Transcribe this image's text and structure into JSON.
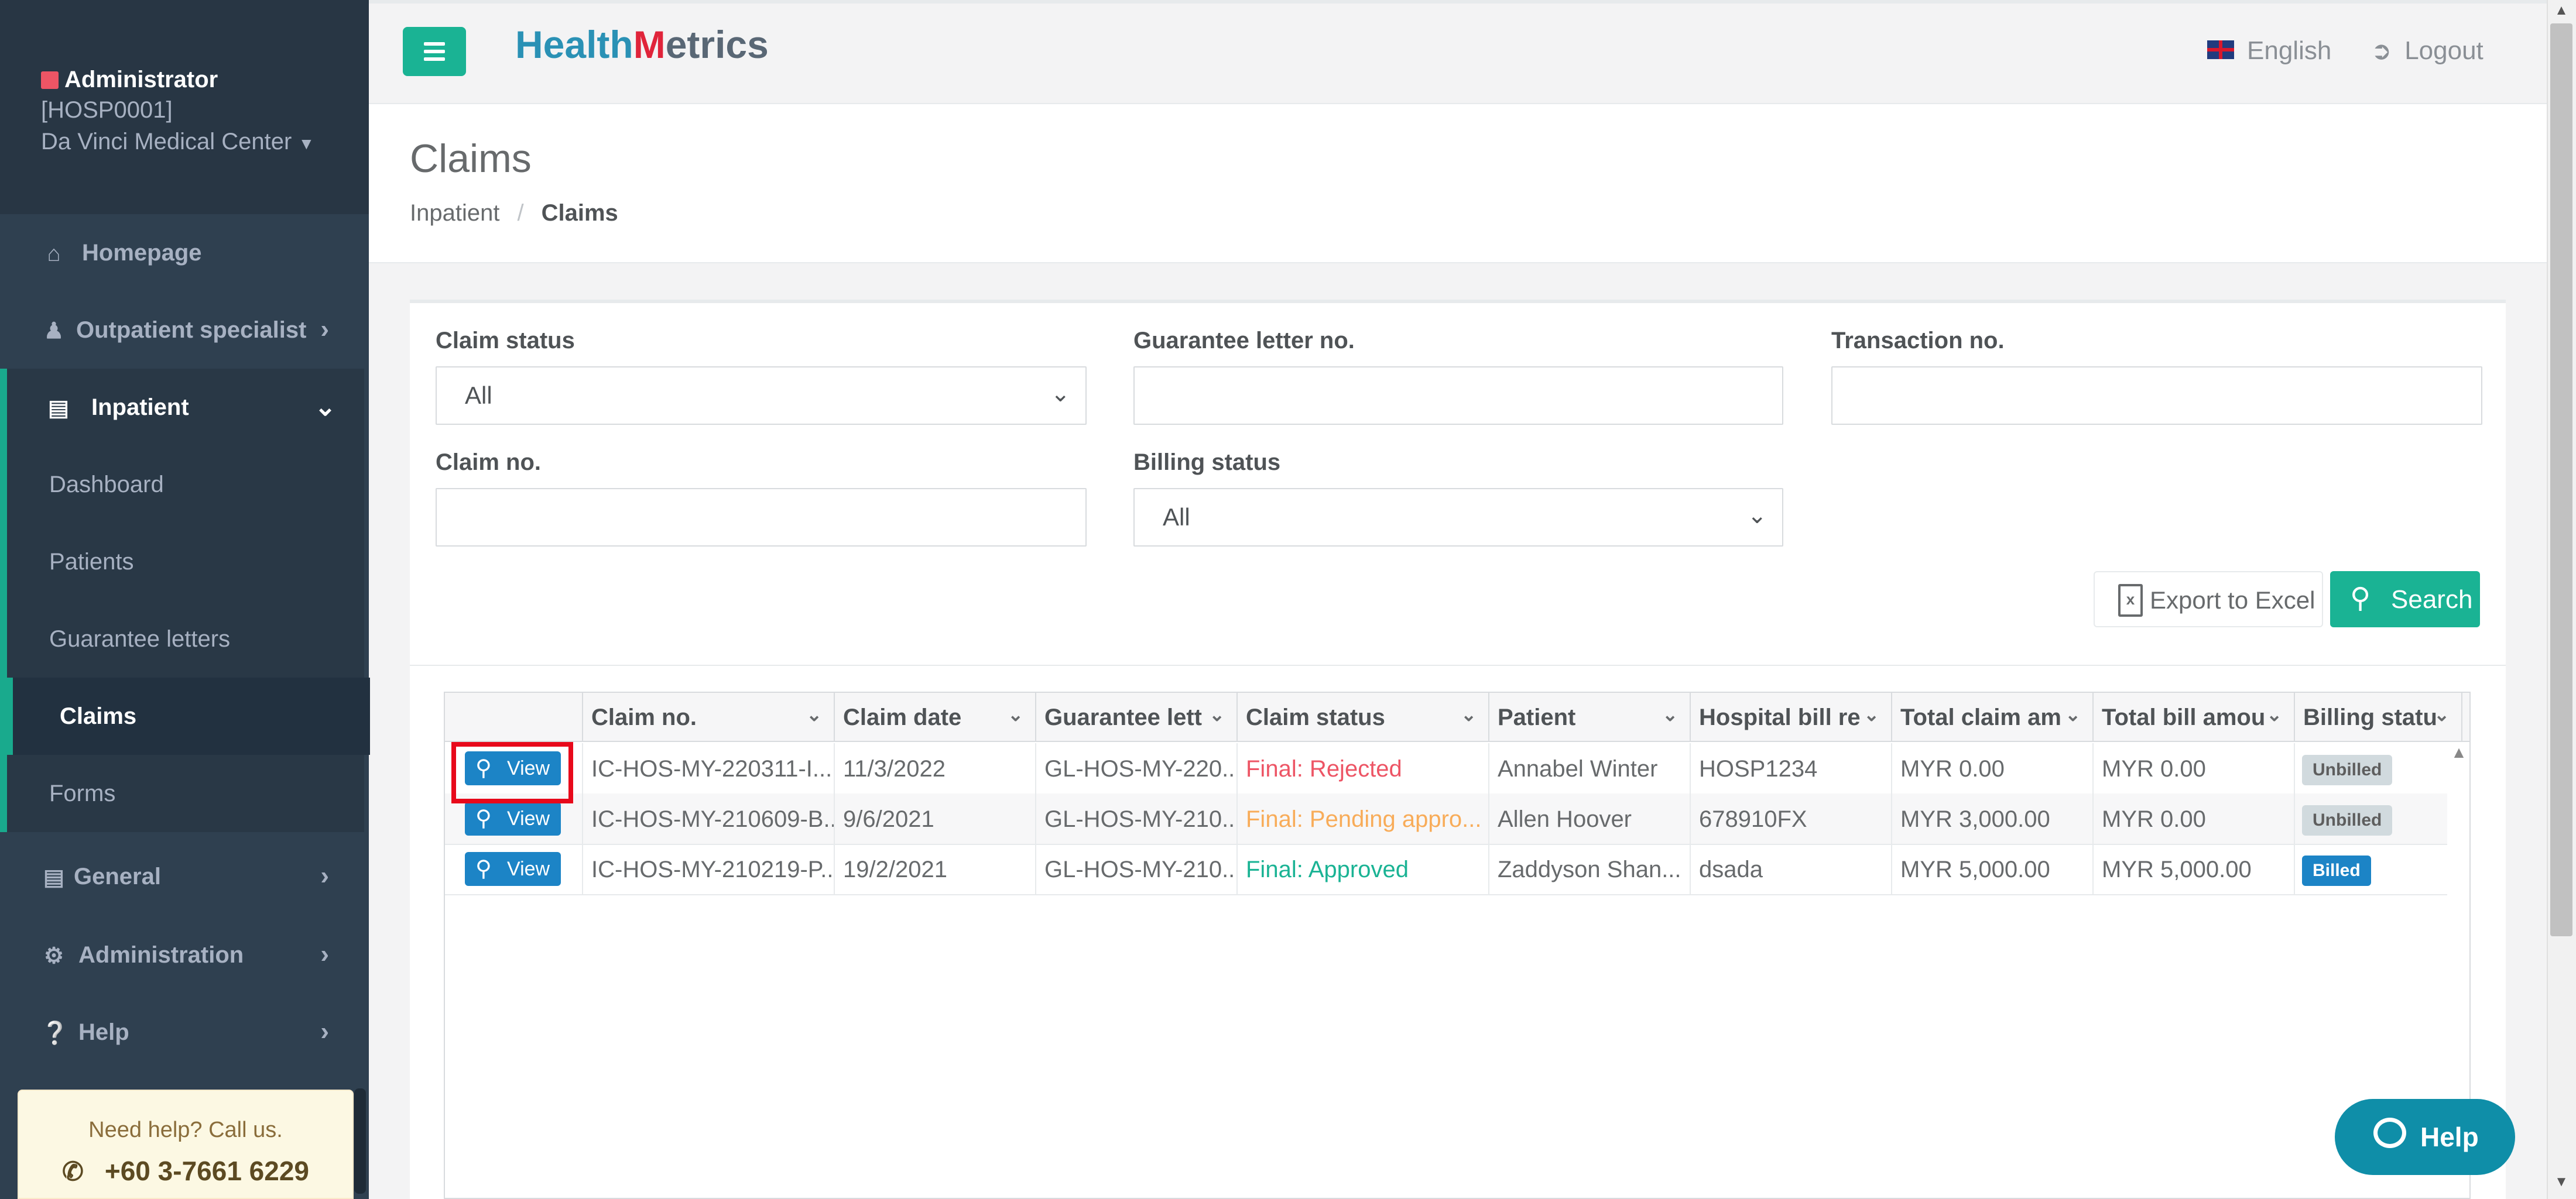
{
  "profile": {
    "role": "Administrator",
    "code": "[HOSP0001]",
    "organization": "Da Vinci Medical Center"
  },
  "nav": {
    "homepage": "Homepage",
    "outpatient": "Outpatient specialist",
    "inpatient": "Inpatient",
    "inpatient_children": {
      "dashboard": "Dashboard",
      "patients": "Patients",
      "guarantee_letters": "Guarantee letters",
      "claims": "Claims",
      "forms": "Forms"
    },
    "general": "General",
    "administration": "Administration",
    "help": "Help"
  },
  "help_box": {
    "title": "Need help? Call us.",
    "phone": "+60 3-7661 6229"
  },
  "topbar": {
    "logo_part1": "Health",
    "logo_part2": "M",
    "logo_part3": "etrics",
    "language": "English",
    "logout": "Logout"
  },
  "page": {
    "title": "Claims",
    "breadcrumb": [
      "Inpatient",
      "/",
      "Claims"
    ]
  },
  "filters": {
    "claim_status_label": "Claim status",
    "claim_status_value": "All",
    "guarantee_letter_label": "Guarantee letter no.",
    "guarantee_letter_value": "",
    "transaction_label": "Transaction no.",
    "transaction_value": "",
    "claim_no_label": "Claim no.",
    "claim_no_value": "",
    "billing_status_label": "Billing status",
    "billing_status_value": "All",
    "export_label": "Export to Excel",
    "search_label": "Search"
  },
  "table": {
    "columns": [
      "",
      "Claim no.",
      "Claim date",
      "Guarantee lett",
      "Claim status",
      "Patient",
      "Hospital bill re",
      "Total claim am",
      "Total bill amou",
      "Billing statu"
    ],
    "view_label": "View",
    "rows": [
      {
        "claim_no": "IC-HOS-MY-220311-I...",
        "claim_date": "11/3/2022",
        "guarantee_letter": "GL-HOS-MY-220...",
        "claim_status": "Final: Rejected",
        "patient": "Annabel Winter",
        "hospital_bill_ref": "HOSP1234",
        "total_claim": "MYR 0.00",
        "total_bill": "MYR 0.00",
        "billing_status": "Unbilled"
      },
      {
        "claim_no": "IC-HOS-MY-210609-B...",
        "claim_date": "9/6/2021",
        "guarantee_letter": "GL-HOS-MY-210...",
        "claim_status": "Final: Pending appro...",
        "patient": "Allen Hoover",
        "hospital_bill_ref": "678910FX",
        "total_claim": "MYR 3,000.00",
        "total_bill": "MYR 0.00",
        "billing_status": "Unbilled"
      },
      {
        "claim_no": "IC-HOS-MY-210219-P...",
        "claim_date": "19/2/2021",
        "guarantee_letter": "GL-HOS-MY-210...",
        "claim_status": "Final: Approved",
        "patient": "Zaddyson Shan...",
        "hospital_bill_ref": "dsada",
        "total_claim": "MYR 5,000.00",
        "total_bill": "MYR 5,000.00",
        "billing_status": "Billed"
      }
    ]
  },
  "help_fab": "Help",
  "colors": {
    "sidebar": "#2f4050",
    "accent": "#1ab394",
    "primary": "#1c84c6",
    "rejected": "#ed5565",
    "pending": "#f8ac59",
    "highlight": "#e8091b"
  }
}
